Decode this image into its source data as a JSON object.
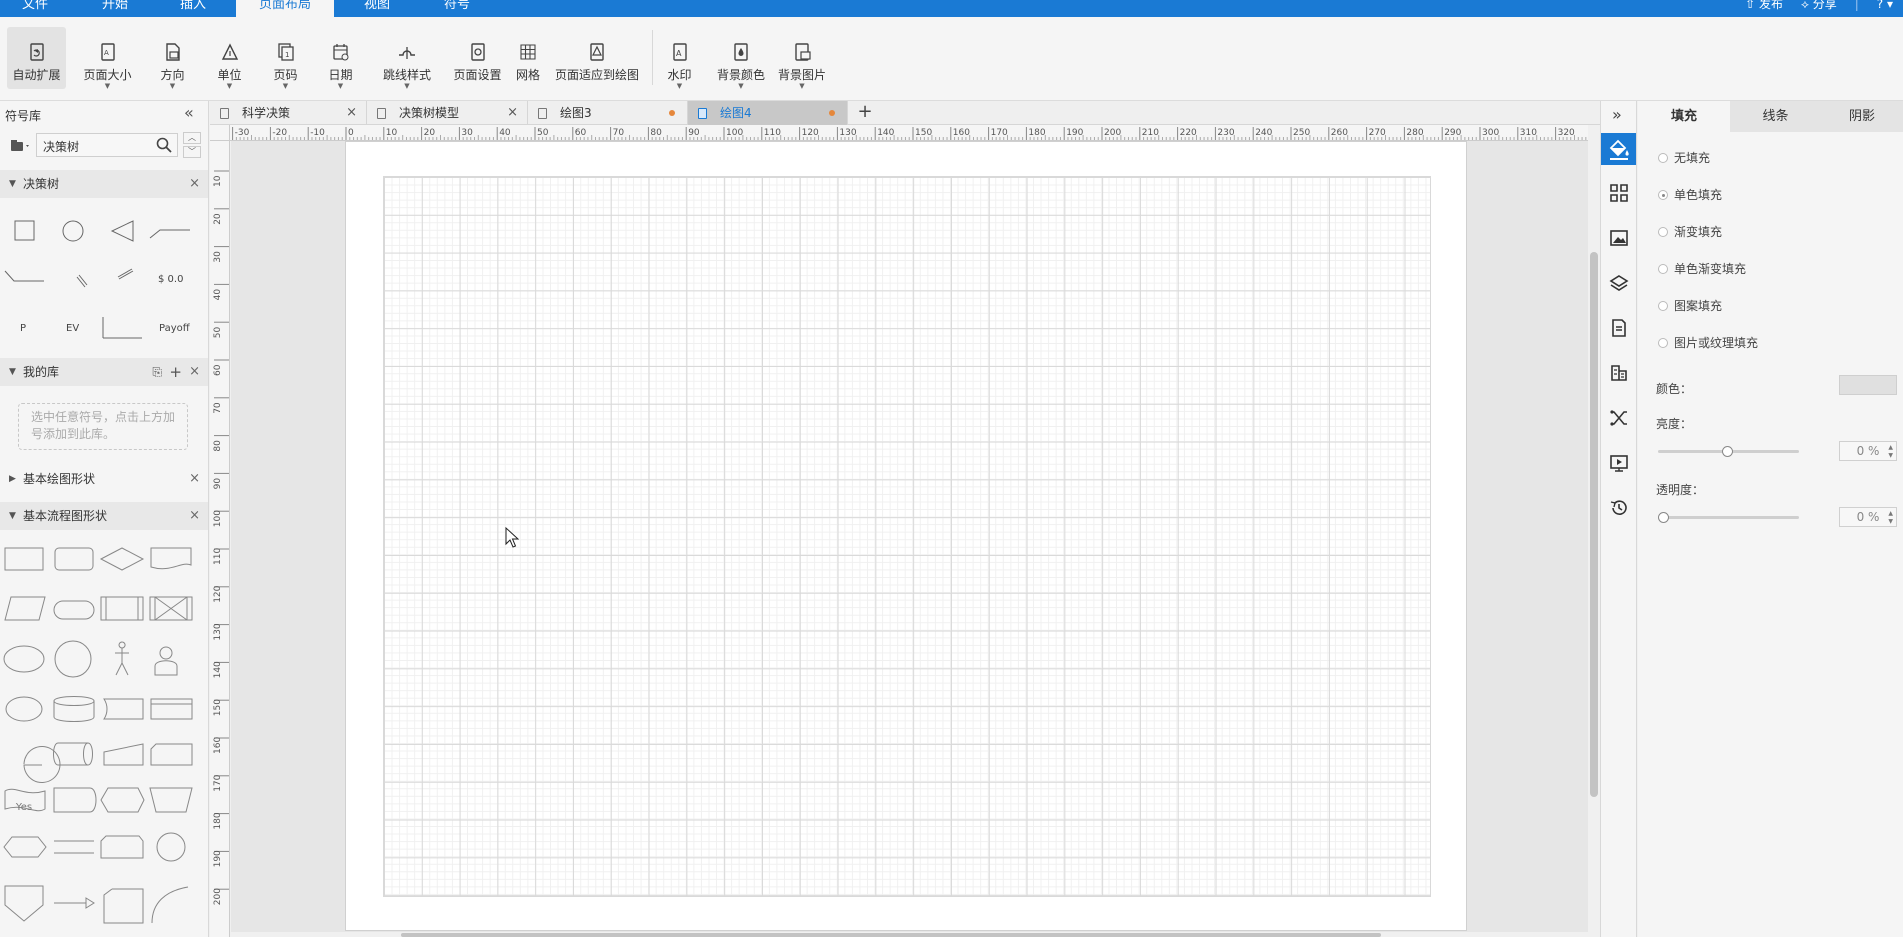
{
  "menu": {
    "items": [
      "文件",
      "开始",
      "插入",
      "页面布局",
      "视图",
      "符号"
    ],
    "active_index": 3,
    "publish": "发布",
    "share": "分享",
    "help": "?"
  },
  "toolbar": {
    "auto_expand": "自动扩展",
    "page_size": "页面大小",
    "orientation": "方向",
    "unit": "单位",
    "page_number": "页码",
    "date": "日期",
    "jump_line_style": "跳线样式",
    "page_setup": "页面设置",
    "grid": "网格",
    "fit_to_drawing": "页面适应到绘图",
    "watermark": "水印",
    "bg_color": "背景颜色",
    "bg_image": "背景图片"
  },
  "library": {
    "title": "符号库",
    "search_value": "决策树",
    "sections": {
      "decision_tree": "决策树",
      "my_library": "我的库",
      "my_library_hint": "选中任意符号，点击上方加号添加到此库。",
      "basic_drawing": "基本绘图形状",
      "basic_flowchart": "基本流程图形状"
    },
    "shape_labels": {
      "value": "$ 0.0",
      "p": "P",
      "ev": "EV",
      "payoff": "Payoff",
      "yes": "Yes"
    }
  },
  "tabs": [
    {
      "label": "科学决策",
      "state": "close"
    },
    {
      "label": "决策树模型",
      "state": "close"
    },
    {
      "label": "绘图3",
      "state": "modified"
    },
    {
      "label": "绘图4",
      "state": "modified"
    }
  ],
  "active_tab": 3,
  "add_tab": "+",
  "ruler": {
    "top": [
      "-30",
      "-20",
      "-10",
      "0",
      "10",
      "20",
      "30",
      "40",
      "50",
      "60",
      "70",
      "80",
      "90",
      "100",
      "110",
      "120",
      "130",
      "140",
      "150",
      "160",
      "170",
      "180",
      "190",
      "200",
      "210",
      "220",
      "230",
      "240",
      "250",
      "260",
      "270",
      "280",
      "290",
      "300",
      "310",
      "320"
    ],
    "left": [
      "10",
      "20",
      "30",
      "40",
      "50",
      "60",
      "70",
      "80",
      "90",
      "100",
      "110",
      "120",
      "130",
      "140",
      "150",
      "160",
      "170",
      "180",
      "190",
      "200"
    ]
  },
  "properties": {
    "tabs": [
      "填充",
      "线条",
      "阴影"
    ],
    "active_tab": 0,
    "fill_options": [
      "无填充",
      "单色填充",
      "渐变填充",
      "单色渐变填充",
      "图案填充",
      "图片或纹理填充"
    ],
    "selected_fill": 1,
    "color_label": "颜色：",
    "brightness_label": "亮度：",
    "brightness": 0,
    "brightness_value": "0 %",
    "transparency_label": "透明度：",
    "transparency": 0,
    "transparency_value": "0 %"
  },
  "colors": {
    "accent": "#1a7ad4",
    "modified_dot": "#e5873b"
  },
  "icons": [
    "collapse-left-icon",
    "expand-right-icon",
    "fill-bucket-icon",
    "grid-layout-icon",
    "image-icon",
    "layers-icon",
    "page-icon",
    "org-chart-icon",
    "shuffle-icon",
    "presentation-icon",
    "history-icon",
    "search-icon",
    "cursor-icon"
  ]
}
